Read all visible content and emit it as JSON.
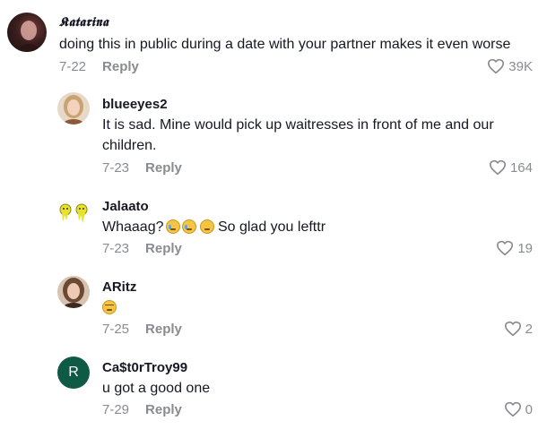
{
  "comments": [
    {
      "username": "𝕶𝖆𝖙𝖆𝖗𝖎𝖓𝖆",
      "text": "doing this in public during a date with your partner makes it even worse",
      "date": "7-22",
      "reply": "Reply",
      "likes": "39K"
    },
    {
      "username": "blueeyes2",
      "text": "It is sad. Mine would pick up waitresses in front of me and our children.",
      "date": "7-23",
      "reply": "Reply",
      "likes": "164"
    },
    {
      "username": "Jalaato",
      "text_prefix": "Whaaag?",
      "text_suffix": " So glad you lefttr",
      "date": "7-23",
      "reply": "Reply",
      "likes": "19"
    },
    {
      "username": "ARitz",
      "date": "7-25",
      "reply": "Reply",
      "likes": "2"
    },
    {
      "username": "Ca$t0rTroy99",
      "avatar_letter": "R",
      "text": "u got a good one",
      "date": "7-29",
      "reply": "Reply",
      "likes": "0"
    }
  ],
  "colors": {
    "muted": "#8a8b91",
    "text": "#161823",
    "avatar_r": "#0f5a45"
  }
}
